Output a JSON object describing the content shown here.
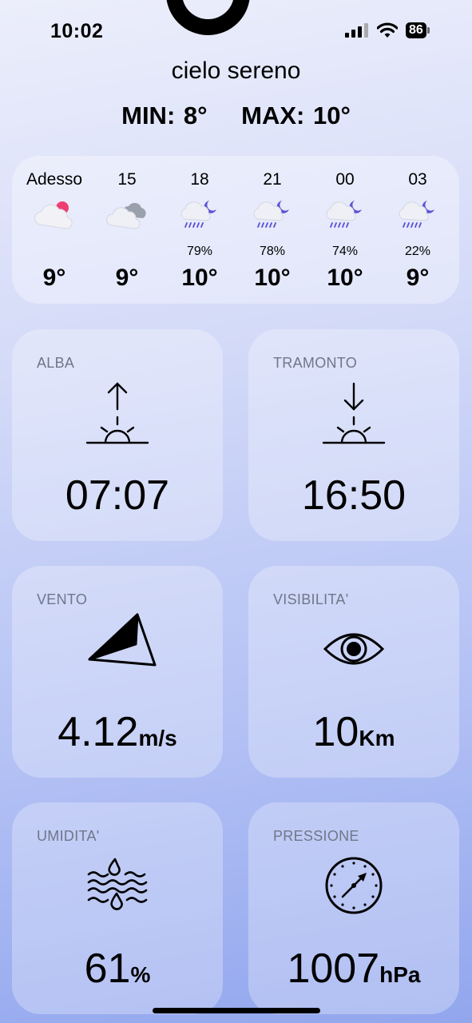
{
  "status_bar": {
    "time": "10:02",
    "battery": "86"
  },
  "weather": {
    "condition": "cielo sereno",
    "min": "MIN: 8°",
    "max": "MAX: 10°"
  },
  "hourly": [
    {
      "label": "Adesso",
      "icon": "cloud-sun-icon",
      "precip": "",
      "temp": "9°"
    },
    {
      "label": "15",
      "icon": "clouds-icon",
      "precip": "",
      "temp": "9°"
    },
    {
      "label": "18",
      "icon": "rain-moon-icon",
      "precip": "79%",
      "temp": "10°"
    },
    {
      "label": "21",
      "icon": "rain-moon-icon",
      "precip": "78%",
      "temp": "10°"
    },
    {
      "label": "00",
      "icon": "rain-moon-icon",
      "precip": "74%",
      "temp": "10°"
    },
    {
      "label": "03",
      "icon": "rain-moon-icon",
      "precip": "22%",
      "temp": "9°"
    }
  ],
  "cards": {
    "sunrise": {
      "title": "ALBA",
      "value": "07:07",
      "icon": "sunrise-icon"
    },
    "sunset": {
      "title": "TRAMONTO",
      "value": "16:50",
      "icon": "sunset-icon"
    },
    "wind": {
      "title": "VENTO",
      "value": "4.12",
      "unit": "m/s",
      "icon": "wind-direction-icon"
    },
    "visibility": {
      "title": "VISIBILITA'",
      "value": "10",
      "unit": "Km",
      "icon": "eye-icon"
    },
    "humidity": {
      "title": "UMIDITA'",
      "value": "61",
      "unit": "%",
      "icon": "humidity-icon"
    },
    "pressure": {
      "title": "PRESSIONE",
      "value": "1007",
      "unit": "hPa",
      "icon": "gauge-icon"
    }
  }
}
